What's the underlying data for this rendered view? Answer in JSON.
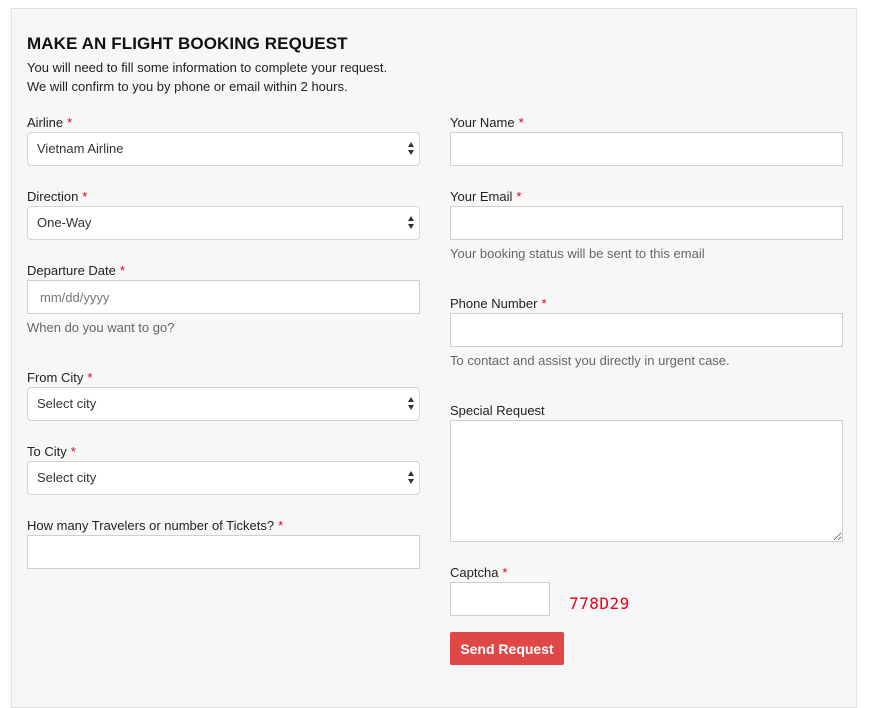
{
  "form": {
    "title": "MAKE AN FLIGHT BOOKING REQUEST",
    "intro_line1": "You will need to fill some information to complete your request.",
    "intro_line2": "We will confirm to you by phone or email within 2 hours.",
    "required_mark": "*",
    "airline": {
      "label": "Airline",
      "value": "Vietnam Airline"
    },
    "direction": {
      "label": "Direction",
      "value": "One-Way"
    },
    "departure_date": {
      "label": "Departure Date",
      "placeholder": "mm/dd/yyyy",
      "help": "When do you want to go?"
    },
    "from_city": {
      "label": "From City",
      "value": "Select city"
    },
    "to_city": {
      "label": "To City",
      "value": "Select city"
    },
    "travelers": {
      "label": "How many Travelers or number of Tickets?",
      "value": ""
    },
    "name": {
      "label": "Your Name",
      "value": ""
    },
    "email": {
      "label": "Your Email",
      "value": "",
      "help": "Your booking status will be sent to this email"
    },
    "phone": {
      "label": "Phone Number",
      "value": "",
      "help": "To contact and assist you directly in urgent case."
    },
    "special_request": {
      "label": "Special Request",
      "value": ""
    },
    "captcha": {
      "label": "Captcha",
      "value": "",
      "code": "778D29"
    },
    "submit_label": "Send Request"
  },
  "colors": {
    "required": "#d0021b",
    "button_bg": "#e04848",
    "captcha_code": "#e8001c",
    "panel_bg": "#f7f7f7"
  }
}
